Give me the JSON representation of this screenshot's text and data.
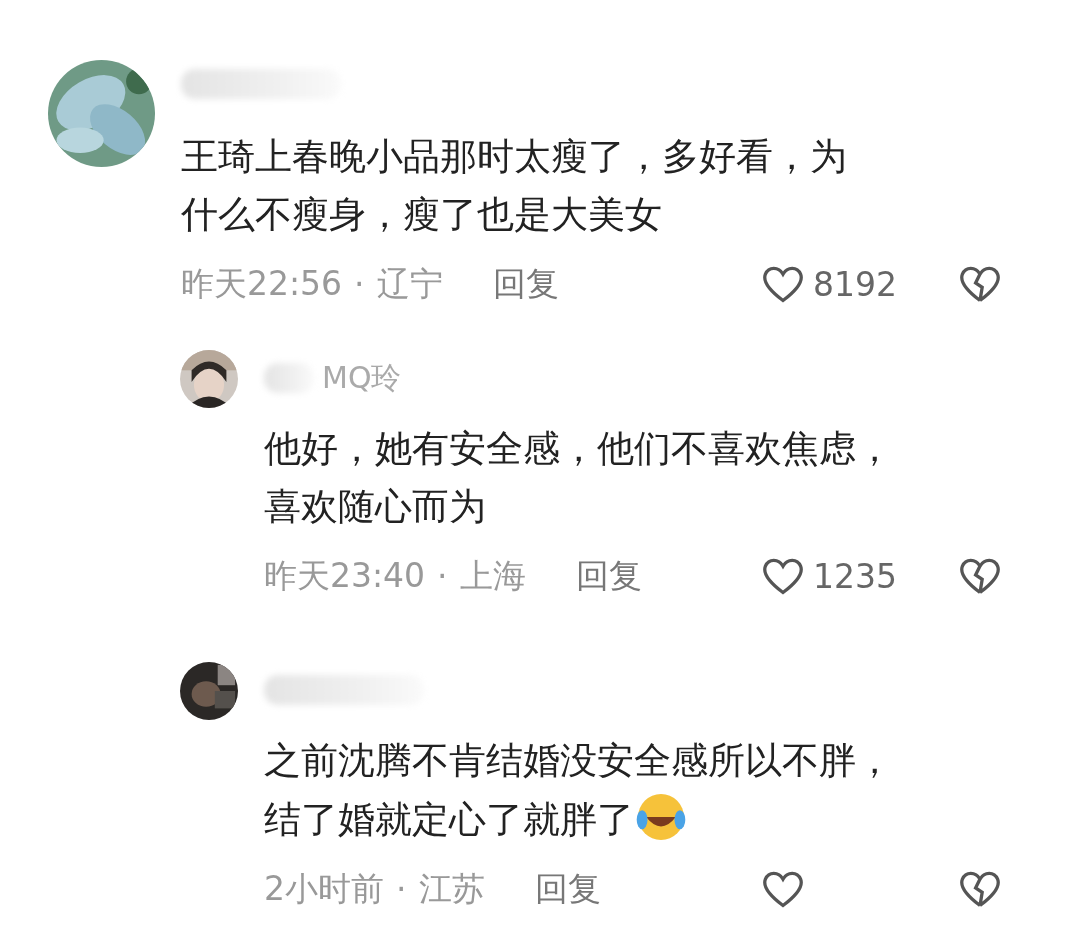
{
  "comments": [
    {
      "kind": "top",
      "avatar": {
        "kind": "picture"
      },
      "name_hidden": true,
      "lines": [
        "王琦上春晚小品那时太瘦了，多好看，为",
        "什么不瘦身，瘦了也是大美女"
      ],
      "emoji": false,
      "time": "昨天22:56",
      "separator": "·",
      "location": "辽宁",
      "reply": "回复",
      "likes": "8192"
    },
    {
      "kind": "reply",
      "avatar": {
        "kind": "picture"
      },
      "name": "MQ玲",
      "name_hidden": true,
      "lines": [
        "他好，她有安全感，他们不喜欢焦虑，",
        "喜欢随心而为"
      ],
      "emoji": false,
      "time": "昨天23:40",
      "separator": "·",
      "location": "上海",
      "reply": "回复",
      "likes": "1235"
    },
    {
      "kind": "reply",
      "avatar": {
        "kind": "picture"
      },
      "name_hidden": true,
      "lines": [
        "之前沈腾不肯结婚没安全感所以不胖，",
        "结了婚就定心了就胖了"
      ],
      "emoji": true,
      "time": "2小时前",
      "separator": "·",
      "location": "江苏",
      "reply": "回复"
    }
  ]
}
